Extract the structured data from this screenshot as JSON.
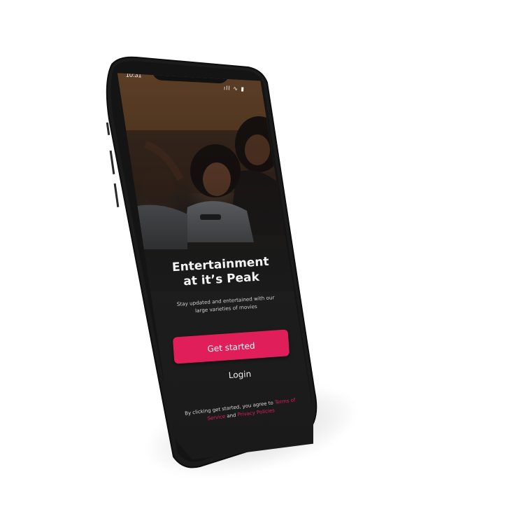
{
  "status_bar": {
    "time": "10:31",
    "icons": "••• ◉ ▮"
  },
  "onboarding": {
    "headline": "Entertainment at it’s Peak",
    "subtitle": "Stay updated and entertained with our large varieties of movies",
    "get_started_label": "Get started",
    "login_label": "Login",
    "terms_prefix": "By clicking get started, you agree to ",
    "terms_link": "Terms of Service",
    "terms_and": " and ",
    "privacy_link": "Privacy Policies"
  },
  "colors": {
    "accent": "#e01e5a",
    "screen_background": "#1a1a1a",
    "phone_frame": "#1b1b1b",
    "page_background": "#ffffff"
  },
  "icons": {
    "signal": "signal-icon",
    "wifi": "wifi-icon",
    "battery": "battery-icon"
  }
}
